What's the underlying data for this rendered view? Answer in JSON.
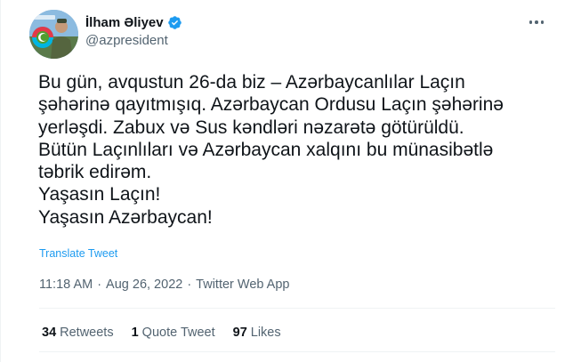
{
  "tweet": {
    "author": {
      "display_name": "İlham Əliyev",
      "handle": "@azpresident",
      "verified": true,
      "avatar_icon": "avatar-with-azerbaijan-flag-emblem"
    },
    "text": "Bu gün, avqustun 26-da biz – Azərbaycanlılar Laçın\nşəhərinə qayıtmışıq. Azərbaycan Ordusu Laçın şəhərinə\nyerləşdi. Zabux və Sus kəndləri nəzarətə götürüldü.\nBütün Laçınlıları və Azərbaycan xalqını bu münasibətlə\ntəbrik edirəm.\nYaşasın Laçın!\nYaşasın Azərbaycan!",
    "translate_label": "Translate Tweet",
    "time": "11:18 AM",
    "date": "Aug 26, 2022",
    "source": "Twitter Web App",
    "separator": "·",
    "stats": {
      "retweets_count": "34",
      "retweets_label": "Retweets",
      "quotes_count": "1",
      "quotes_label": "Quote Tweet",
      "likes_count": "97",
      "likes_label": "Likes"
    }
  },
  "colors": {
    "accent": "#1d9bf0",
    "text": "#0f1419",
    "secondary_text": "#536471",
    "divider": "#eff3f4",
    "flag_blue": "#00b5e2",
    "flag_red": "#ef3340",
    "flag_green": "#509e2f"
  },
  "icons": {
    "verified": "verified-badge-icon",
    "more": "more-options-icon"
  }
}
